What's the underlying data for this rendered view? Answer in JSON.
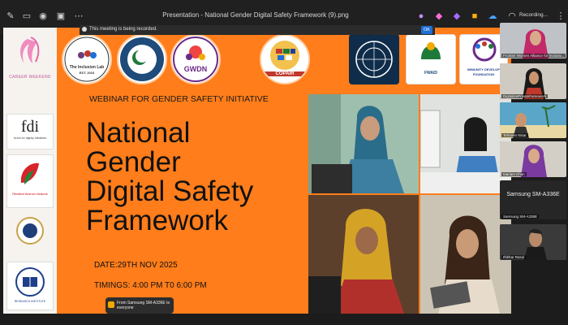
{
  "topbar": {
    "title": "Presentation - National Gender Digital Safety Framework (9).png",
    "recording_status": "Recording...",
    "recording_banner": "This meeting is being recorded.",
    "ok_label": "OK",
    "icons": [
      "pencil-icon",
      "folder-icon",
      "camera-icon",
      "present-icon",
      "more-icon",
      "copilot-icon",
      "onedrive-icon",
      "wifi-icon"
    ]
  },
  "slide": {
    "webinar_label": "WEBINAR FOR GENDER SAFETY INITIATIVE",
    "title_lines": [
      "National",
      "Gender",
      "Digital Safety",
      "Framework"
    ],
    "date": "DATE:29TH NOV 2025",
    "timings": "TIMINGS: 4:00 PM T0 6:00 PM",
    "top_logos": [
      {
        "name": "The Inclusion Lab",
        "sub": "EST. 2023"
      },
      {
        "name": "COMMISSION",
        "sub": ""
      },
      {
        "name": "GWDN",
        "sub": ""
      },
      {
        "name": "COPAIR",
        "sub": ""
      },
      {
        "name": "MMMO",
        "sub": ""
      },
      {
        "name": "FWAID",
        "sub": ""
      },
      {
        "name": "IMMUNITY DEVELOP",
        "sub": "FOUNDATION"
      }
    ],
    "left_logos": [
      {
        "name": "CAREER WEEKEND"
      },
      {
        "name": "fdi",
        "sub": "forum for dignity initiatives"
      },
      {
        "name": "Resilient Women Network"
      },
      {
        "name": ""
      },
      {
        "name": "RESEARCH INSTITUTE"
      }
    ]
  },
  "toast": {
    "line1": "From Samsung SM-A336E to",
    "line2": "everyone"
  },
  "participants": [
    {
      "name": "Frontier Women Alliance for Inclusiv..."
    },
    {
      "name": "DigitalizePrivateframework"
    },
    {
      "name": "Tehseen Nisar"
    },
    {
      "name": "Mariam Khan"
    },
    {
      "name": "Samsung SM-A336E",
      "label": "Samsung SM-A336E"
    },
    {
      "name": "Iftikhar Rasul"
    }
  ],
  "colors": {
    "slide_bg": "#ff7d1a",
    "accent": "#1f6fd6"
  }
}
